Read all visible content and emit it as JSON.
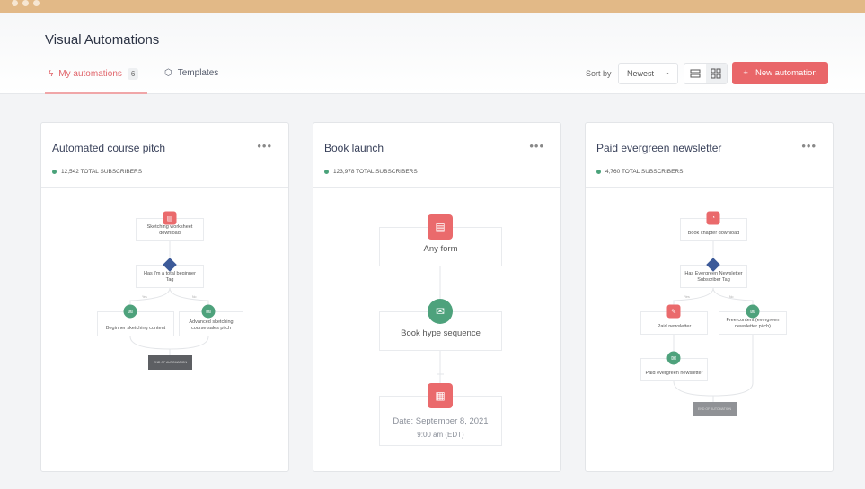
{
  "header": {
    "title": "Visual Automations"
  },
  "tabs": [
    {
      "label": "My automations",
      "count": "6",
      "icon": "lightning-icon"
    },
    {
      "label": "Templates",
      "icon": "cube-icon"
    }
  ],
  "toolbar": {
    "sort_label": "Sort by",
    "sort_value": "Newest",
    "new_label": "New automation",
    "view": "grid"
  },
  "colors": {
    "accent": "#e96669",
    "topbar": "#e2b987",
    "green": "#4ea27c",
    "blue": "#3c5a99"
  },
  "cards": [
    {
      "title": "Automated course pitch",
      "subscribers": "12,542 TOTAL SUBSCRIBERS",
      "nodes": [
        "Sketching worksheet download",
        "Has I'm a total beginner Tag",
        "Beginner sketching content",
        "Advanced sketching course sales pitch"
      ],
      "branch": [
        "Yes",
        "No"
      ],
      "end": "END OF AUTOMATION"
    },
    {
      "title": "Book launch",
      "subscribers": "123,978 TOTAL SUBSCRIBERS",
      "nodes": [
        "Any form",
        "Book hype sequence",
        "Date: September 8, 2021",
        "9:00 am (EDT)"
      ]
    },
    {
      "title": "Paid evergreen newsletter",
      "subscribers": "4,760 TOTAL SUBSCRIBERS",
      "nodes": [
        "Book chapter download",
        "Has Evergreen Newsletter Subscriber Tag",
        "Paid newsletter",
        "Free content (evergreen newsletter pitch)",
        "Paid evergreen newsletter"
      ],
      "branch": [
        "Yes",
        "No"
      ],
      "end": "END OF AUTOMATION"
    }
  ]
}
